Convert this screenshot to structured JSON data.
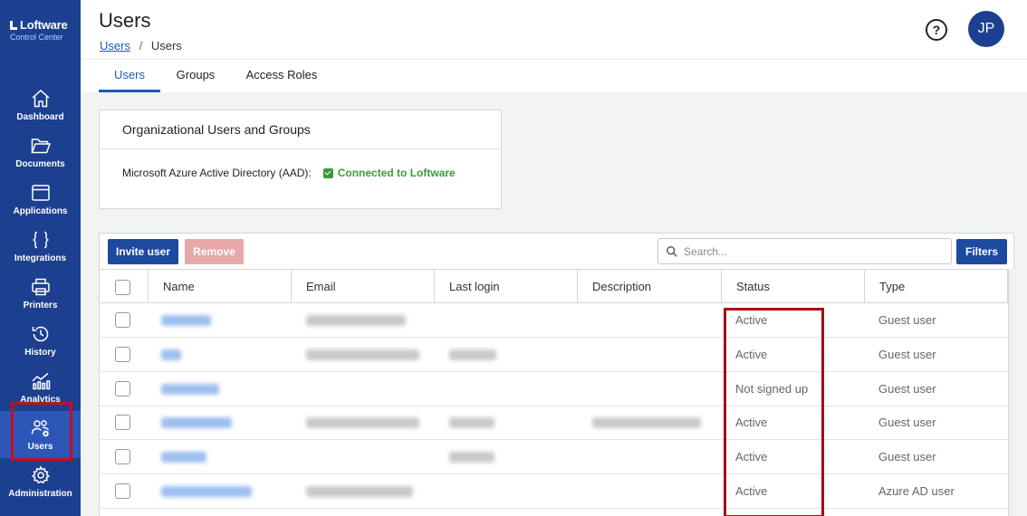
{
  "brand": {
    "name": "Loftware",
    "subtitle": "Control Center"
  },
  "sidebar": {
    "items": [
      {
        "label": "Dashboard",
        "icon": "home-icon"
      },
      {
        "label": "Documents",
        "icon": "folder-icon"
      },
      {
        "label": "Applications",
        "icon": "window-icon"
      },
      {
        "label": "Integrations",
        "icon": "braces-icon"
      },
      {
        "label": "Printers",
        "icon": "printer-icon"
      },
      {
        "label": "History",
        "icon": "history-icon"
      },
      {
        "label": "Analytics",
        "icon": "chart-icon"
      },
      {
        "label": "Users",
        "icon": "users-gear-icon",
        "active": true
      },
      {
        "label": "Administration",
        "icon": "gear-icon"
      }
    ]
  },
  "header": {
    "title": "Users",
    "breadcrumb": {
      "link": "Users",
      "separator": "/",
      "current": "Users"
    },
    "help_glyph": "?",
    "avatar_initials": "JP"
  },
  "tabs": [
    {
      "label": "Users",
      "active": true
    },
    {
      "label": "Groups",
      "active": false
    },
    {
      "label": "Access Roles",
      "active": false
    }
  ],
  "org_card": {
    "title": "Organizational Users and Groups",
    "label": "Microsoft Azure Active Directory (AAD):",
    "status": "Connected to Loftware",
    "status_color": "#3a9b3a"
  },
  "toolbar": {
    "invite_label": "Invite user",
    "remove_label": "Remove",
    "search_placeholder": "Search...",
    "filters_label": "Filters"
  },
  "table": {
    "columns": [
      "Name",
      "Email",
      "Last login",
      "Description",
      "Status",
      "Type"
    ],
    "rows": [
      {
        "status": "Active",
        "type": "Guest user"
      },
      {
        "status": "Active",
        "type": "Guest user"
      },
      {
        "status": "Not signed up",
        "type": "Guest user"
      },
      {
        "status": "Active",
        "type": "Guest user"
      },
      {
        "status": "Active",
        "type": "Guest user"
      },
      {
        "status": "Active",
        "type": "Azure AD user"
      }
    ]
  },
  "colors": {
    "sidebar": "#1d3f8f",
    "accent": "#1b5bbd",
    "highlight": "#c0111f"
  }
}
